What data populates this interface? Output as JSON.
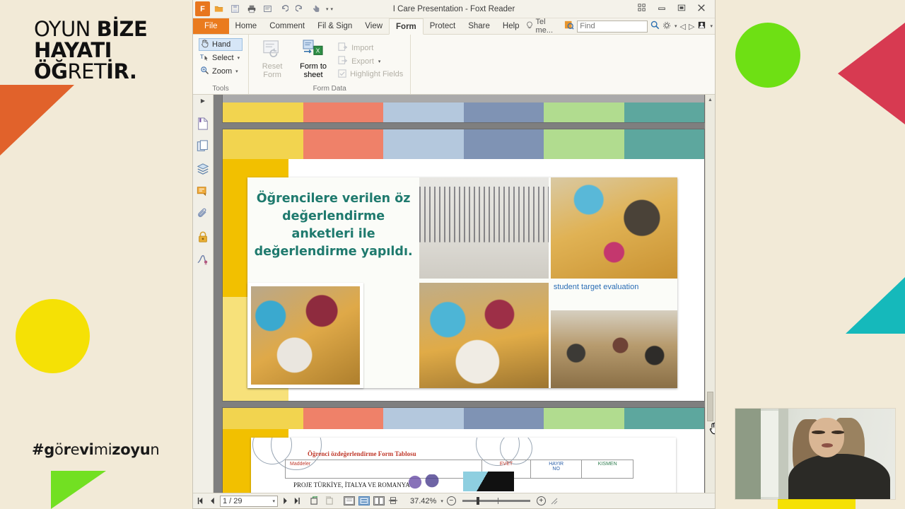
{
  "branding": {
    "title_line1_a": "OYUN ",
    "title_line1_b": "BİZE",
    "title_line2": "HAYATI",
    "title_line3_a": "ÖĞ",
    "title_line3_b": "RET",
    "title_line3_c": "İR.",
    "hashtag_1": "#g",
    "hashtag_2": "ö",
    "hashtag_3": "r",
    "hashtag_4": "e",
    "hashtag_5": "vi",
    "hashtag_6": "mi",
    "hashtag_7": "zo",
    "hashtag_8": "yu",
    "hashtag_9": "n"
  },
  "colors": {
    "page_background": "#f2ead7",
    "accent_orange": "#e1622b",
    "accent_yellow": "#f5e105",
    "accent_green": "#6ee014",
    "accent_red": "#d73a51",
    "accent_teal": "#15b9bb",
    "file_tab_orange": "#ea7b1e",
    "heading_teal": "#1f7a6e",
    "label_blue": "#2a6db5"
  },
  "window": {
    "title": "I Care Presentation - Foxt Reader",
    "quick_access": [
      "app-logo",
      "open-folder",
      "save",
      "print",
      "print-preview",
      "undo",
      "redo",
      "touch-mode",
      "customize"
    ],
    "controls": [
      "restore-layout",
      "minimize",
      "maximize",
      "close"
    ]
  },
  "ribbon": {
    "tabs": [
      {
        "label": "File",
        "kind": "file"
      },
      {
        "label": "Home",
        "kind": "normal"
      },
      {
        "label": "Comment",
        "kind": "normal"
      },
      {
        "label": "Fil & Sign",
        "kind": "normal"
      },
      {
        "label": "View",
        "kind": "normal"
      },
      {
        "label": "Form",
        "kind": "active"
      },
      {
        "label": "Protect",
        "kind": "normal"
      },
      {
        "label": "Share",
        "kind": "normal"
      },
      {
        "label": "Help",
        "kind": "normal"
      }
    ],
    "tell_me": "Tel me...",
    "find_placeholder": "Find",
    "groups": [
      {
        "label": "Tools",
        "items": [
          "Hand",
          "Select",
          "Zoom"
        ]
      },
      {
        "label": "Form Data",
        "reset_label_1": "Reset",
        "reset_label_2": "Form",
        "formto_label_1": "Form to",
        "formto_label_2": "sheet",
        "items": [
          "Import",
          "Export",
          "Highlight Fields"
        ]
      }
    ]
  },
  "sidebar": {
    "items": [
      {
        "name": "bookmarks-panel",
        "icon": "page-icon"
      },
      {
        "name": "thumbnails-panel",
        "icon": "thumbnails-icon"
      },
      {
        "name": "layers-panel",
        "icon": "layers-icon"
      },
      {
        "name": "comments-panel",
        "icon": "comment-icon"
      },
      {
        "name": "attachments-panel",
        "icon": "paperclip-icon"
      },
      {
        "name": "security-panel",
        "icon": "lock-icon"
      },
      {
        "name": "signatures-panel",
        "icon": "signature-icon"
      }
    ]
  },
  "document": {
    "main_slide": {
      "heading": "Öğrencilere verilen öz değerlendirme anketleri ile değerlendirme yapıldı.",
      "photo_caption": "student target evaluation",
      "strip_colors": [
        "#f2d44f",
        "#ef8169",
        "#b4c8dd",
        "#7f93b4",
        "#b1dc8f",
        "#5da79e"
      ]
    },
    "bottom_slide": {
      "form_title": "Öğrenci özdeğerlendirme Form Tablosu",
      "table_headers": [
        "Maddeler",
        "EVET",
        "HAYIR NO",
        "KISMEN"
      ],
      "header_hayir_line1": "HAYIR",
      "header_hayir_line2": "NO",
      "subtitle": "PROJE TÜRKİYE, İTALYA VE ROMANYA"
    }
  },
  "status_bar": {
    "page_value": "1 / 29",
    "zoom_value": "37.42%",
    "nav_buttons": [
      "first-page",
      "previous-page",
      "next-page",
      "last-page"
    ],
    "view_buttons": [
      "single-page-view",
      "continuous-view",
      "facing-view",
      "split-view"
    ],
    "rotate_buttons": [
      "rotate-left",
      "rotate-right"
    ]
  }
}
